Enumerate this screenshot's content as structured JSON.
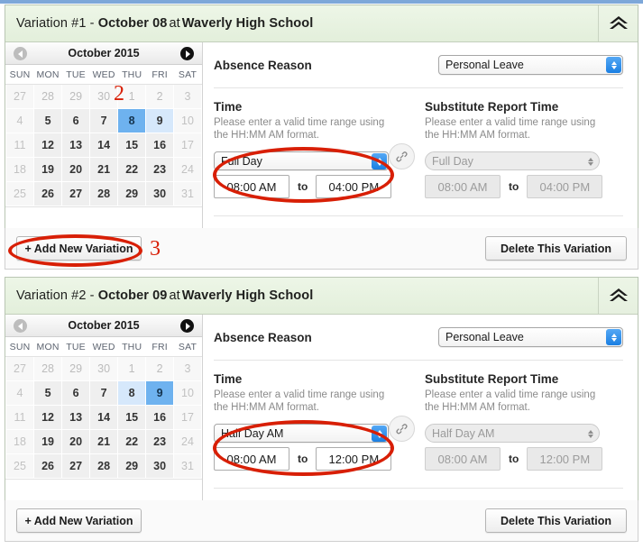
{
  "calendar_common": {
    "month_label": "October 2015",
    "weekdays": [
      "SUN",
      "MON",
      "TUE",
      "WED",
      "THU",
      "FRI",
      "SAT"
    ],
    "prev_icon": "chevron-left-icon",
    "next_icon": "chevron-right-icon"
  },
  "labels": {
    "absence_reason": "Absence Reason",
    "time": "Time",
    "substitute_report_time": "Substitute Report Time",
    "hint": "Please enter a valid time range using the HH:MM AM format.",
    "to": "to",
    "add_new_variation": "+ Add New Variation",
    "delete_this_variation": "Delete This Variation",
    "collapse_icon": "chevron-double-up-icon",
    "link_icon": "chain-link-icon"
  },
  "colors": {
    "header_green": "#e7f1e0",
    "selected_day": "#6eb2ef",
    "highlight_day": "#d6e8fb",
    "annotation_red": "#d81f06",
    "stepper_blue": "#1a7fe3"
  },
  "annotations": [
    {
      "id": "ann-2",
      "text": "2"
    },
    {
      "id": "ann-3",
      "text": "3"
    }
  ],
  "variations": [
    {
      "title_prefix": "Variation #1 - ",
      "date": "October 08",
      "at": "at",
      "school": "Waverly High School",
      "absence_reason": "Personal Leave",
      "calendar": {
        "weeks": [
          [
            {
              "d": "27",
              "c": "wk"
            },
            {
              "d": "28",
              "c": "off"
            },
            {
              "d": "29",
              "c": "off"
            },
            {
              "d": "30",
              "c": "off"
            },
            {
              "d": "1",
              "c": "off"
            },
            {
              "d": "2",
              "c": "off"
            },
            {
              "d": "3",
              "c": "wk"
            }
          ],
          [
            {
              "d": "4",
              "c": "wk"
            },
            {
              "d": "5",
              "c": ""
            },
            {
              "d": "6",
              "c": ""
            },
            {
              "d": "7",
              "c": ""
            },
            {
              "d": "8",
              "c": "sel"
            },
            {
              "d": "9",
              "c": "hl"
            },
            {
              "d": "10",
              "c": "wk"
            }
          ],
          [
            {
              "d": "11",
              "c": "wk"
            },
            {
              "d": "12",
              "c": ""
            },
            {
              "d": "13",
              "c": ""
            },
            {
              "d": "14",
              "c": ""
            },
            {
              "d": "15",
              "c": ""
            },
            {
              "d": "16",
              "c": ""
            },
            {
              "d": "17",
              "c": "wk"
            }
          ],
          [
            {
              "d": "18",
              "c": "wk"
            },
            {
              "d": "19",
              "c": ""
            },
            {
              "d": "20",
              "c": ""
            },
            {
              "d": "21",
              "c": ""
            },
            {
              "d": "22",
              "c": ""
            },
            {
              "d": "23",
              "c": ""
            },
            {
              "d": "24",
              "c": "wk"
            }
          ],
          [
            {
              "d": "25",
              "c": "wk"
            },
            {
              "d": "26",
              "c": ""
            },
            {
              "d": "27",
              "c": ""
            },
            {
              "d": "28",
              "c": ""
            },
            {
              "d": "29",
              "c": ""
            },
            {
              "d": "30",
              "c": ""
            },
            {
              "d": "31",
              "c": "wk"
            }
          ]
        ]
      },
      "time": {
        "duration": "Full Day",
        "start": "08:00 AM",
        "end": "04:00 PM"
      },
      "substitute": {
        "duration": "Full Day",
        "start": "08:00 AM",
        "end": "04:00 PM"
      }
    },
    {
      "title_prefix": "Variation #2 - ",
      "date": "October 09",
      "at": "at",
      "school": "Waverly High School",
      "absence_reason": "Personal Leave",
      "calendar": {
        "weeks": [
          [
            {
              "d": "27",
              "c": "wk"
            },
            {
              "d": "28",
              "c": "off"
            },
            {
              "d": "29",
              "c": "off"
            },
            {
              "d": "30",
              "c": "off"
            },
            {
              "d": "1",
              "c": "off"
            },
            {
              "d": "2",
              "c": "off"
            },
            {
              "d": "3",
              "c": "wk"
            }
          ],
          [
            {
              "d": "4",
              "c": "wk"
            },
            {
              "d": "5",
              "c": ""
            },
            {
              "d": "6",
              "c": ""
            },
            {
              "d": "7",
              "c": ""
            },
            {
              "d": "8",
              "c": "hl"
            },
            {
              "d": "9",
              "c": "sel"
            },
            {
              "d": "10",
              "c": "wk"
            }
          ],
          [
            {
              "d": "11",
              "c": "wk"
            },
            {
              "d": "12",
              "c": ""
            },
            {
              "d": "13",
              "c": ""
            },
            {
              "d": "14",
              "c": ""
            },
            {
              "d": "15",
              "c": ""
            },
            {
              "d": "16",
              "c": ""
            },
            {
              "d": "17",
              "c": "wk"
            }
          ],
          [
            {
              "d": "18",
              "c": "wk"
            },
            {
              "d": "19",
              "c": ""
            },
            {
              "d": "20",
              "c": ""
            },
            {
              "d": "21",
              "c": ""
            },
            {
              "d": "22",
              "c": ""
            },
            {
              "d": "23",
              "c": ""
            },
            {
              "d": "24",
              "c": "wk"
            }
          ],
          [
            {
              "d": "25",
              "c": "wk"
            },
            {
              "d": "26",
              "c": ""
            },
            {
              "d": "27",
              "c": ""
            },
            {
              "d": "28",
              "c": ""
            },
            {
              "d": "29",
              "c": ""
            },
            {
              "d": "30",
              "c": ""
            },
            {
              "d": "31",
              "c": "wk"
            }
          ]
        ]
      },
      "time": {
        "duration": "Half Day AM",
        "start": "08:00 AM",
        "end": "12:00 PM"
      },
      "substitute": {
        "duration": "Half Day AM",
        "start": "08:00 AM",
        "end": "12:00 PM"
      }
    }
  ]
}
